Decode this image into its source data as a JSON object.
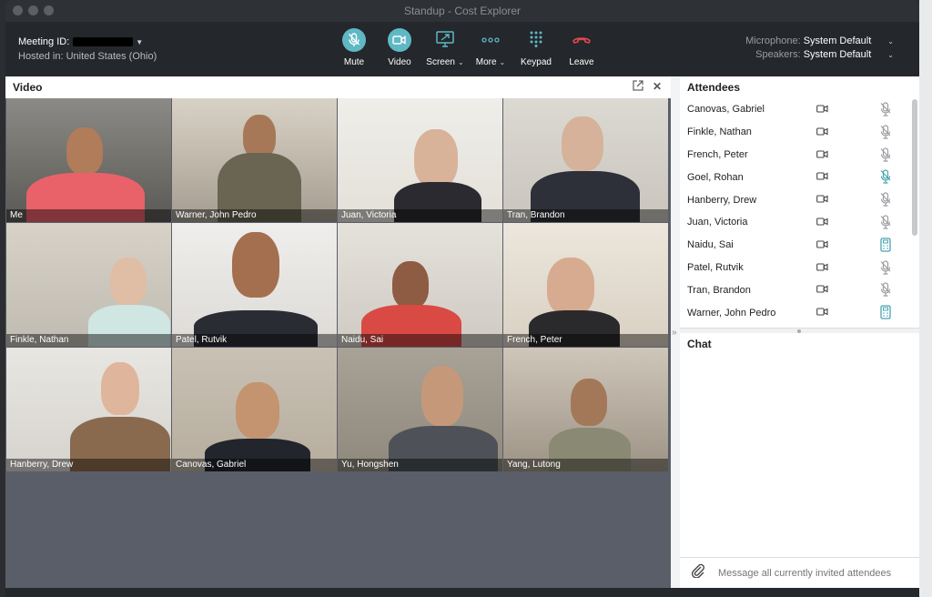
{
  "window": {
    "title": "Standup - Cost Explorer"
  },
  "meeting": {
    "id_label": "Meeting ID:",
    "hosted": "Hosted in: United States (Ohio)"
  },
  "controls": [
    {
      "label": "Mute",
      "icon": "mic-icon"
    },
    {
      "label": "Video",
      "icon": "video-camera-icon"
    },
    {
      "label": "Screen",
      "icon": "screen-share-icon",
      "dropdown": true
    },
    {
      "label": "More",
      "icon": "more-dots-icon",
      "dropdown": true
    },
    {
      "label": "Keypad",
      "icon": "keypad-icon"
    },
    {
      "label": "Leave",
      "icon": "hang-up-icon"
    }
  ],
  "audio": {
    "microphone_label": "Microphone:",
    "microphone_value": "System Default",
    "speakers_label": "Speakers:",
    "speakers_value": "System Default"
  },
  "video": {
    "title": "Video",
    "tiles": [
      {
        "name": "Me"
      },
      {
        "name": "Warner, John Pedro"
      },
      {
        "name": "Juan, Victoria"
      },
      {
        "name": "Tran, Brandon"
      },
      {
        "name": "Finkle, Nathan"
      },
      {
        "name": "Patel, Rutvik"
      },
      {
        "name": "Naidu, Sai"
      },
      {
        "name": "French, Peter"
      },
      {
        "name": "Hanberry, Drew"
      },
      {
        "name": "Canovas, Gabriel"
      },
      {
        "name": "Yu, Hongshen"
      },
      {
        "name": "Yang, Lutong"
      }
    ]
  },
  "attendees": {
    "title": "Attendees",
    "list": [
      {
        "name": "Canovas, Gabriel",
        "mic": "muted"
      },
      {
        "name": "Finkle, Nathan",
        "mic": "muted"
      },
      {
        "name": "French, Peter",
        "mic": "muted"
      },
      {
        "name": "Goel, Rohan",
        "mic": "active"
      },
      {
        "name": "Hanberry, Drew",
        "mic": "muted"
      },
      {
        "name": "Juan, Victoria",
        "mic": "muted"
      },
      {
        "name": "Naidu, Sai",
        "mic": "phone"
      },
      {
        "name": "Patel, Rutvik",
        "mic": "muted"
      },
      {
        "name": "Tran, Brandon",
        "mic": "muted"
      },
      {
        "name": "Warner, John Pedro",
        "mic": "phone"
      }
    ]
  },
  "chat": {
    "title": "Chat",
    "placeholder": "Message all currently invited attendees"
  },
  "colors": {
    "accent": "#5fb8c4",
    "leave": "#e0474c",
    "toolbar_bg": "#24272b"
  }
}
